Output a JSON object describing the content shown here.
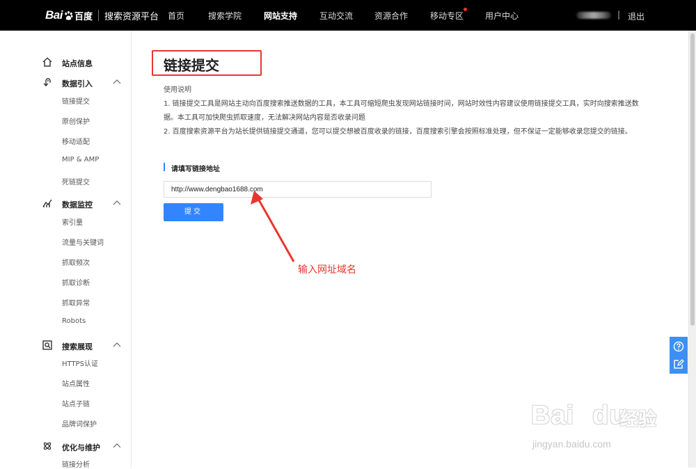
{
  "header": {
    "logo_bai": "Bai",
    "logo_cn": "百度",
    "platform": "搜索资源平台",
    "nav": [
      {
        "label": "首页"
      },
      {
        "label": "搜索学院"
      },
      {
        "label": "网站支持"
      },
      {
        "label": "互动交流"
      },
      {
        "label": "资源合作"
      },
      {
        "label": "移动专区"
      },
      {
        "label": "用户中心"
      }
    ],
    "separator": "|",
    "logout": "退出"
  },
  "sidebar": {
    "groups": [
      {
        "label": "站点信息",
        "icon": "home-icon"
      },
      {
        "label": "数据引入",
        "icon": "data-import-icon",
        "items": [
          "链接提交",
          "原创保护",
          "移动适配",
          "MIP & AMP",
          "死链提交"
        ]
      },
      {
        "label": "数据监控",
        "icon": "chart-monitor-icon",
        "items": [
          "索引量",
          "流量与关键词",
          "抓取频次",
          "抓取诊断",
          "抓取异常",
          "Robots"
        ]
      },
      {
        "label": "搜索展现",
        "icon": "search-display-icon",
        "items": [
          "HTTPS认证",
          "站点属性",
          "站点子链",
          "品牌词保护"
        ]
      },
      {
        "label": "优化与维护",
        "icon": "optimize-icon",
        "items": [
          "链接分析"
        ]
      }
    ]
  },
  "main": {
    "title": "链接提交",
    "usage_label": "使用说明",
    "usage_lines": [
      "1. 链接提交工具是网站主动向百度搜索推送数据的工具，本工具可缩短爬虫发现网站链接时间，网站时效性内容建议使用链接提交工具，实时向搜索推送数",
      "据。本工具可加快爬虫抓取速度，无法解决网站内容是否收录问题",
      "2. 百度搜索资源平台为站长提供链接提交通道，您可以提交想被百度收录的链接，百度搜索引擎会按照标准处理，但不保证一定能够收录您提交的链接。"
    ],
    "section_title": "请填写链接地址",
    "url_value": "http://www.dengbao1688.com",
    "submit_label": "提交",
    "annotation": "输入网址域名"
  },
  "watermark": {
    "big": "Bai",
    "big2": "du",
    "cn": "经验",
    "url": "jingyan.baidu.com"
  },
  "colors": {
    "accent": "#3385ff",
    "annotation_red": "#e8362e",
    "topbar": "#000000"
  }
}
